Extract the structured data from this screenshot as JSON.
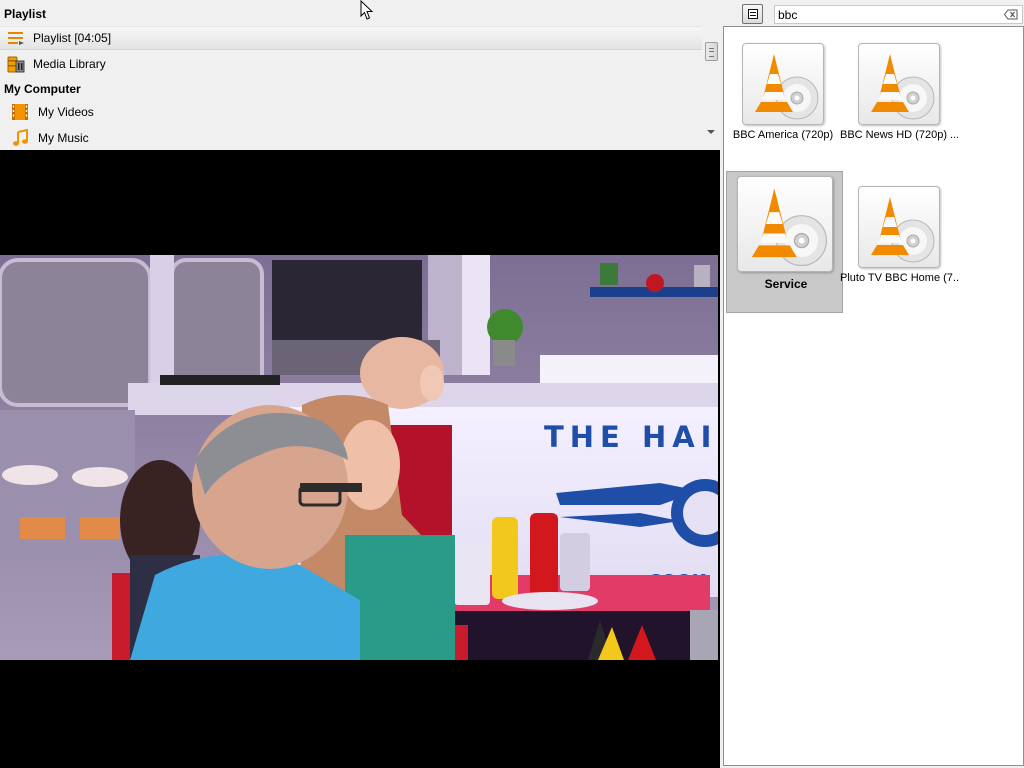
{
  "sidebar": {
    "playlist_header": "Playlist",
    "items_top": [
      {
        "label": "Playlist [04:05]",
        "icon": "playlist-icon"
      },
      {
        "label": "Media Library",
        "icon": "media-library-icon"
      }
    ],
    "computer_header": "My Computer",
    "items_computer": [
      {
        "label": "My Videos",
        "icon": "film-icon"
      },
      {
        "label": "My Music",
        "icon": "music-note-icon"
      }
    ]
  },
  "video": {
    "sign_text": "THE HAIRY"
  },
  "search": {
    "value": "bbc",
    "toggle_icon": "list-view-icon",
    "clear_icon": "clear-search-icon"
  },
  "results": [
    {
      "title": "BBC America (720p)",
      "icon": "vlc-cone-disc-icon",
      "selected": false
    },
    {
      "title": "BBC News HD (720p) ...",
      "icon": "vlc-cone-disc-icon",
      "selected": false
    },
    {
      "title": "Service",
      "icon": "vlc-cone-disc-icon",
      "selected": true
    },
    {
      "title": "Pluto TV BBC Home (7...",
      "icon": "vlc-cone-disc-icon",
      "selected": false
    }
  ],
  "colors": {
    "vlc_orange": "#f28a00",
    "selected_tile": "#c8c8c8",
    "background": "#f0f0f0"
  }
}
